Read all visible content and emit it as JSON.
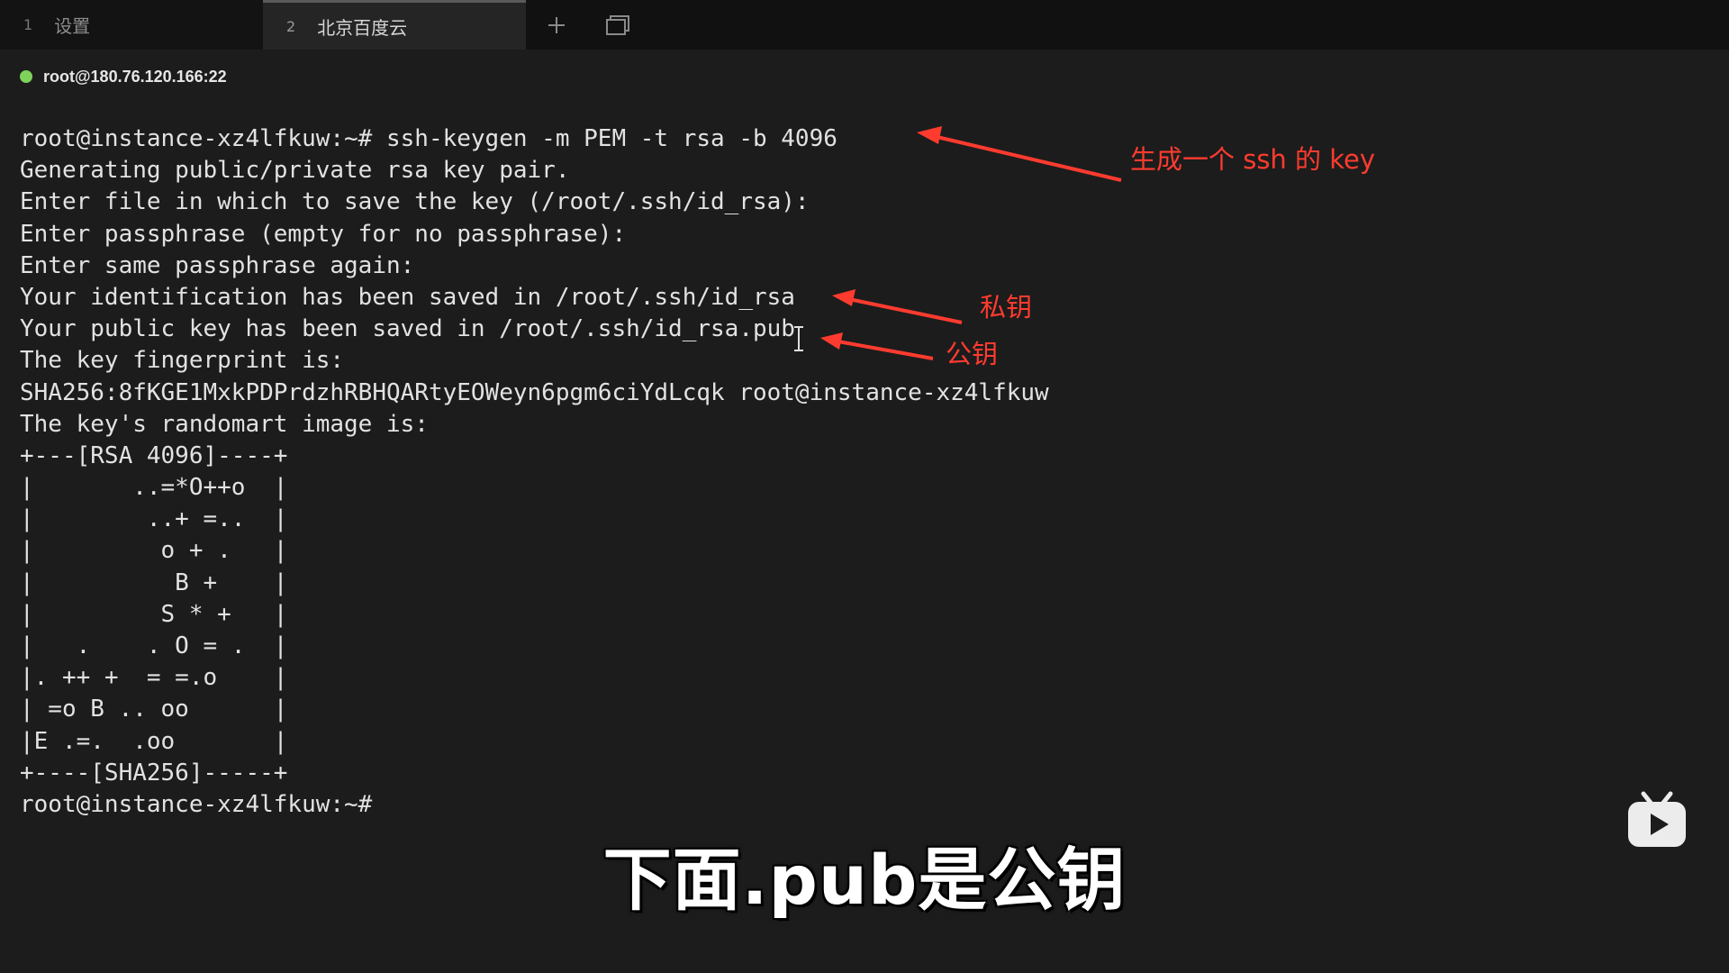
{
  "tabs": [
    {
      "num": "1",
      "label": "设置",
      "active": false
    },
    {
      "num": "2",
      "label": "北京百度云",
      "active": true
    }
  ],
  "tab_actions": {
    "new_tab": "+",
    "window_icon": "window-restore-icon"
  },
  "connection": {
    "status_color": "#7fd35a",
    "host": "root@180.76.120.166:22"
  },
  "terminal": {
    "lines": [
      "root@instance-xz4lfkuw:~# ssh-keygen -m PEM -t rsa -b 4096",
      "Generating public/private rsa key pair.",
      "Enter file in which to save the key (/root/.ssh/id_rsa):",
      "Enter passphrase (empty for no passphrase):",
      "Enter same passphrase again:",
      "Your identification has been saved in /root/.ssh/id_rsa",
      "Your public key has been saved in /root/.ssh/id_rsa.pub",
      "The key fingerprint is:",
      "SHA256:8fKGE1MxkPDPrdzhRBHQARtyEOWeyn6pgm6ciYdLcqk root@instance-xz4lfkuw",
      "The key's randomart image is:",
      "+---[RSA 4096]----+",
      "|       ..=*O++o  |",
      "|        ..+ =..  |",
      "|         o + .   |",
      "|          B +    |",
      "|         S * +   |",
      "|   .    . O = .  |",
      "|. ++ +  = =.o    |",
      "| =o B .. oo      |",
      "|E .=.  .oo       |",
      "+----[SHA256]-----+",
      "root@instance-xz4lfkuw:~#"
    ]
  },
  "annotations": {
    "color": "#ff3b2f",
    "key_label": "生成一个 ssh 的 key",
    "private_label": "私钥",
    "public_label": "公钥"
  },
  "subtitle": "下面.pub是公钥",
  "logo": "bilibili-tv-icon"
}
